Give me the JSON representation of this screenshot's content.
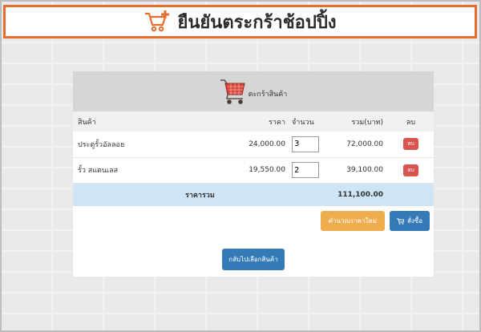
{
  "header": {
    "title": "ยืนยันตระกร้าช้อปปิ้ง",
    "icon": "cart-plus-icon",
    "accent": "#e46e2e"
  },
  "cart": {
    "title": "ตะกร้าสินค้า",
    "icon": "shopping-cart-icon",
    "columns": {
      "product": "สินค้า",
      "price": "ราคา",
      "qty": "จำนวน",
      "total": "รวม(บาท)",
      "delete": "ลบ"
    },
    "items": [
      {
        "name": "ประตูรั้วอัลลอย",
        "price": "24,000.00",
        "qty": "3",
        "total": "72,000.00",
        "delete_label": "ลบ"
      },
      {
        "name": "รั้ว สแตนเลส",
        "price": "19,550.00",
        "qty": "2",
        "total": "39,100.00",
        "delete_label": "ลบ"
      }
    ],
    "total_label": "ราคารวม",
    "total_value": "111,100.00",
    "recalc_label": "คำนวณราคาใหม่",
    "order_label": "สั่งซื้อ",
    "back_label": "กลับไปเลือกสินค้า"
  },
  "colors": {
    "delete": "#d9534f",
    "recalc": "#f0ad4e",
    "primary": "#337ab7",
    "total_row": "#cfe5f7"
  }
}
